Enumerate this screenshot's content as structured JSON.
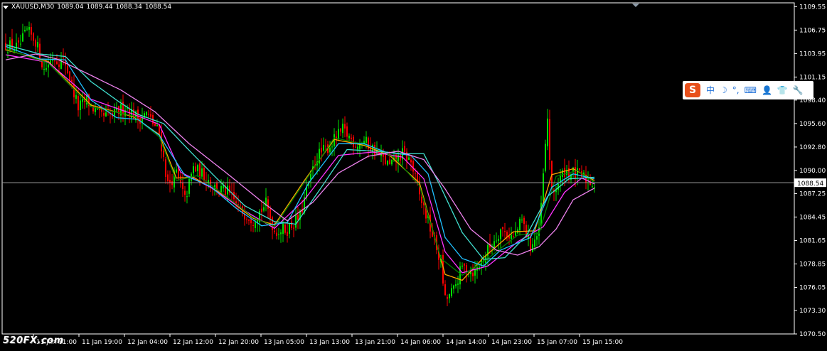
{
  "header": {
    "symbol": "XAUUSD,M30",
    "open": "1089.04",
    "high": "1089.44",
    "low": "1088.34",
    "close": "1088.54"
  },
  "watermark": "520FX.com",
  "ime_toolbar": {
    "logo": "S",
    "items": [
      "中",
      "☽",
      "°,",
      "⌨",
      "👤",
      "👕",
      "🔧"
    ]
  },
  "colors": {
    "background": "#000000",
    "axis": "#ffffff",
    "bull_candle": "#00e000",
    "bear_candle": "#ff0000",
    "bid_line": "#a0a0a0",
    "ma_orange": "#ffa500",
    "ma_magenta": "#ff33ff",
    "ma_darkgreen": "#008000",
    "ma_cyan": "#20c0ff",
    "ma_turquoise": "#40e0d0",
    "ma_violet": "#ee82ee"
  },
  "chart_data": {
    "type": "candlestick",
    "timeframe": "M30",
    "ylim": [
      1070.5,
      1110.0
    ],
    "y_ticks": [
      "1109.55",
      "1106.75",
      "1103.95",
      "1101.15",
      "1098.40",
      "1095.60",
      "1092.80",
      "1090.00",
      "1087.25",
      "1084.45",
      "1081.65",
      "1078.85",
      "1076.05",
      "1073.30",
      "1070.50"
    ],
    "x_ticks": [
      "11 Jan 11:00",
      "11 Jan 19:00",
      "12 Jan 04:00",
      "12 Jan 12:00",
      "12 Jan 20:00",
      "13 Jan 05:00",
      "13 Jan 13:00",
      "13 Jan 21:00",
      "14 Jan 06:00",
      "14 Jan 14:00",
      "14 Jan 23:00",
      "15 Jan 07:00",
      "15 Jan 15:00"
    ],
    "bid_price": "1088.54",
    "close_path": [
      [
        0,
        1105.0
      ],
      [
        6,
        1104.6
      ],
      [
        10,
        1106.6
      ],
      [
        14,
        1105.5
      ],
      [
        18,
        1102.0
      ],
      [
        22,
        1103.5
      ],
      [
        28,
        1102.8
      ],
      [
        34,
        1097.5
      ],
      [
        38,
        1098.4
      ],
      [
        44,
        1096.4
      ],
      [
        50,
        1096.5
      ],
      [
        56,
        1097.7
      ],
      [
        62,
        1096.2
      ],
      [
        66,
        1096.8
      ],
      [
        72,
        1094.5
      ],
      [
        76,
        1088.3
      ],
      [
        80,
        1089.7
      ],
      [
        84,
        1086.5
      ],
      [
        88,
        1090.3
      ],
      [
        94,
        1089.2
      ],
      [
        98,
        1088.0
      ],
      [
        104,
        1087.4
      ],
      [
        110,
        1085.3
      ],
      [
        116,
        1084.2
      ],
      [
        122,
        1086.0
      ],
      [
        126,
        1082.8
      ],
      [
        132,
        1083.0
      ],
      [
        138,
        1084.5
      ],
      [
        142,
        1088.5
      ],
      [
        146,
        1091.7
      ],
      [
        152,
        1093.0
      ],
      [
        158,
        1094.8
      ],
      [
        164,
        1093.2
      ],
      [
        168,
        1093.5
      ],
      [
        174,
        1092.2
      ],
      [
        180,
        1090.5
      ],
      [
        186,
        1092.0
      ],
      [
        190,
        1091.0
      ],
      [
        194,
        1087.0
      ],
      [
        198,
        1084.0
      ],
      [
        204,
        1079.0
      ],
      [
        206,
        1074.5
      ],
      [
        210,
        1075.7
      ],
      [
        214,
        1078.5
      ],
      [
        220,
        1077.9
      ],
      [
        226,
        1080.5
      ],
      [
        232,
        1083.0
      ],
      [
        238,
        1082.0
      ],
      [
        242,
        1084.0
      ],
      [
        246,
        1081.0
      ],
      [
        250,
        1082.5
      ],
      [
        254,
        1096.2
      ],
      [
        256,
        1087.0
      ],
      [
        262,
        1090.0
      ],
      [
        270,
        1089.3
      ],
      [
        276,
        1088.4
      ]
    ],
    "series": [
      {
        "name": "",
        "color_key": "ma_orange",
        "path": [
          [
            0,
            1104.4
          ],
          [
            20,
            1103.0
          ],
          [
            40,
            1097.8
          ],
          [
            60,
            1096.4
          ],
          [
            72,
            1094.3
          ],
          [
            80,
            1089.1
          ],
          [
            88,
            1089.2
          ],
          [
            100,
            1087.4
          ],
          [
            116,
            1084.3
          ],
          [
            126,
            1083.5
          ],
          [
            140,
            1088.8
          ],
          [
            154,
            1093.7
          ],
          [
            168,
            1093.0
          ],
          [
            180,
            1091.8
          ],
          [
            194,
            1088.5
          ],
          [
            206,
            1077.6
          ],
          [
            214,
            1076.9
          ],
          [
            224,
            1079.6
          ],
          [
            238,
            1082.7
          ],
          [
            248,
            1082.8
          ],
          [
            256,
            1089.5
          ],
          [
            266,
            1090.2
          ],
          [
            276,
            1088.8
          ]
        ]
      },
      {
        "name": "",
        "color_key": "ma_magenta",
        "path": [
          [
            0,
            1103.8
          ],
          [
            20,
            1102.9
          ],
          [
            40,
            1098.5
          ],
          [
            60,
            1096.7
          ],
          [
            72,
            1095.5
          ],
          [
            82,
            1089.8
          ],
          [
            96,
            1088.0
          ],
          [
            112,
            1085.2
          ],
          [
            126,
            1083.1
          ],
          [
            140,
            1086.5
          ],
          [
            156,
            1091.8
          ],
          [
            172,
            1092.2
          ],
          [
            186,
            1091.6
          ],
          [
            196,
            1089.0
          ],
          [
            206,
            1080.3
          ],
          [
            214,
            1077.8
          ],
          [
            226,
            1078.6
          ],
          [
            240,
            1081.5
          ],
          [
            252,
            1083.3
          ],
          [
            262,
            1087.4
          ],
          [
            270,
            1089.1
          ],
          [
            276,
            1088.4
          ]
        ]
      },
      {
        "name": "",
        "color_key": "ma_darkgreen",
        "path": [
          [
            0,
            1104.5
          ],
          [
            20,
            1102.8
          ],
          [
            40,
            1097.6
          ],
          [
            60,
            1096.5
          ],
          [
            72,
            1094.0
          ],
          [
            80,
            1088.8
          ],
          [
            90,
            1089.4
          ],
          [
            102,
            1087.2
          ],
          [
            116,
            1084.4
          ],
          [
            126,
            1083.3
          ],
          [
            140,
            1088.6
          ],
          [
            154,
            1093.9
          ],
          [
            170,
            1093.0
          ],
          [
            182,
            1091.6
          ],
          [
            194,
            1088.2
          ],
          [
            204,
            1079.5
          ],
          [
            214,
            1077.5
          ],
          [
            226,
            1079.5
          ],
          [
            240,
            1082.3
          ],
          [
            250,
            1082.5
          ],
          [
            258,
            1089.3
          ],
          [
            268,
            1090.0
          ],
          [
            276,
            1088.6
          ]
        ]
      },
      {
        "name": "",
        "color_key": "ma_cyan",
        "path": [
          [
            0,
            1104.8
          ],
          [
            16,
            1103.3
          ],
          [
            28,
            1103.2
          ],
          [
            40,
            1098.4
          ],
          [
            52,
            1096.3
          ],
          [
            62,
            1096.1
          ],
          [
            72,
            1094.2
          ],
          [
            84,
            1089.4
          ],
          [
            96,
            1088.1
          ],
          [
            108,
            1085.5
          ],
          [
            120,
            1083.4
          ],
          [
            132,
            1083.8
          ],
          [
            142,
            1088.5
          ],
          [
            156,
            1093.2
          ],
          [
            168,
            1093.2
          ],
          [
            178,
            1092.2
          ],
          [
            190,
            1091.8
          ],
          [
            198,
            1089.6
          ],
          [
            206,
            1082.0
          ],
          [
            214,
            1079.5
          ],
          [
            224,
            1078.6
          ],
          [
            232,
            1080.5
          ],
          [
            246,
            1082.0
          ],
          [
            256,
            1088.0
          ],
          [
            266,
            1089.6
          ],
          [
            276,
            1089.0
          ]
        ]
      },
      {
        "name": "",
        "color_key": "ma_turquoise",
        "path": [
          [
            0,
            1105.0
          ],
          [
            16,
            1103.9
          ],
          [
            28,
            1103.6
          ],
          [
            40,
            1100.6
          ],
          [
            52,
            1098.4
          ],
          [
            62,
            1096.7
          ],
          [
            74,
            1095.6
          ],
          [
            86,
            1092.4
          ],
          [
            98,
            1089.3
          ],
          [
            112,
            1085.8
          ],
          [
            126,
            1083.9
          ],
          [
            136,
            1083.6
          ],
          [
            148,
            1088.0
          ],
          [
            160,
            1092.5
          ],
          [
            174,
            1092.3
          ],
          [
            186,
            1092.0
          ],
          [
            196,
            1092.0
          ],
          [
            204,
            1088.0
          ],
          [
            214,
            1082.6
          ],
          [
            224,
            1079.4
          ],
          [
            234,
            1079.6
          ],
          [
            244,
            1082.2
          ],
          [
            254,
            1086.9
          ],
          [
            264,
            1089.0
          ],
          [
            276,
            1089.2
          ]
        ]
      },
      {
        "name": "",
        "color_key": "ma_violet",
        "path": [
          [
            0,
            1103.2
          ],
          [
            14,
            1103.9
          ],
          [
            24,
            1103.3
          ],
          [
            38,
            1101.6
          ],
          [
            54,
            1099.6
          ],
          [
            70,
            1097.0
          ],
          [
            86,
            1093.2
          ],
          [
            104,
            1089.6
          ],
          [
            120,
            1086.3
          ],
          [
            132,
            1084.0
          ],
          [
            144,
            1086.2
          ],
          [
            156,
            1089.7
          ],
          [
            170,
            1091.7
          ],
          [
            184,
            1092.3
          ],
          [
            196,
            1091.3
          ],
          [
            206,
            1087.8
          ],
          [
            218,
            1083.0
          ],
          [
            230,
            1080.5
          ],
          [
            240,
            1079.9
          ],
          [
            250,
            1080.9
          ],
          [
            258,
            1083.0
          ],
          [
            266,
            1086.5
          ],
          [
            276,
            1087.9
          ]
        ]
      }
    ]
  }
}
